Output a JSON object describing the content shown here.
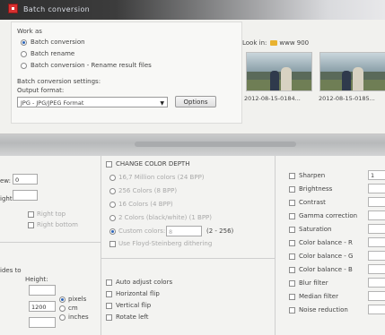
{
  "titlebar": {
    "title": "Batch conversion"
  },
  "work_as": {
    "heading": "Work as",
    "options": [
      "Batch conversion",
      "Batch rename",
      "Batch conversion - Rename result files"
    ],
    "selected_index": 0
  },
  "settings": {
    "heading": "Batch conversion settings:",
    "output_format_label": "Output format:",
    "output_format_value": "JPG - JPG/JPEG Format",
    "options_button": "Options"
  },
  "browser": {
    "look_in_label": "Look in:",
    "folder_name": "www 900",
    "thumbnails": [
      {
        "caption": "2012-08-15-0184..."
      },
      {
        "caption": "2012-08-15-0185..."
      }
    ]
  },
  "size": {
    "field1_value": "0",
    "field2_label": "ight:",
    "right_top": "Right top",
    "right_bottom": "Right bottom",
    "resize_label": "ides to",
    "height_label": "Height:",
    "height_value": "1200",
    "units": [
      "pixels",
      "cm",
      "inches"
    ],
    "unit_selected": 0
  },
  "color_depth": {
    "change_label": "CHANGE COLOR DEPTH",
    "options": [
      "16,7 Million colors (24 BPP)",
      "256 Colors (8 BPP)",
      "16 Colors (4 BPP)",
      "2 Colors (black/white) (1 BPP)"
    ],
    "custom_label": "Custom colors:",
    "custom_from": "8",
    "custom_to_label": "(2 - 256)",
    "dithering_label": "Use Floyd-Steinberg dithering",
    "auto_adjust": "Auto adjust colors",
    "horizontal_flip": "Horizontal flip",
    "vertical_flip": "Vertical flip",
    "rotate_last": "Rotate left"
  },
  "adjustments": {
    "items": [
      "Sharpen",
      "Brightness",
      "Contrast",
      "Gamma correction",
      "Saturation",
      "Color balance - R",
      "Color balance - G",
      "Color balance - B",
      "Blur filter",
      "Median filter",
      "Noise reduction"
    ],
    "sharpen_value": "1"
  }
}
